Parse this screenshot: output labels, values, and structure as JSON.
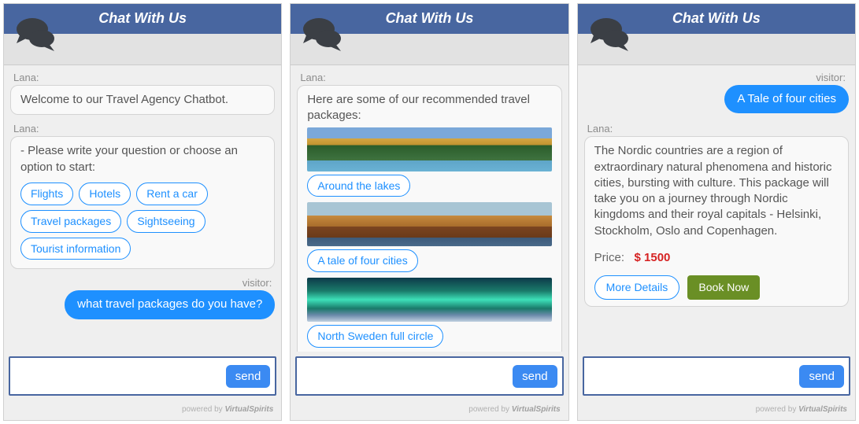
{
  "common": {
    "title": "Chat With Us",
    "send": "send",
    "footer_prefix": "powered  by",
    "footer_brand": "VirtualSpirits",
    "bot_name": "Lana:",
    "visitor_name": "visitor:"
  },
  "panel1": {
    "msg1": "Welcome to our Travel Agency Chatbot.",
    "msg2_intro": "- Please write your question or choose an option to start:",
    "chips": [
      "Flights",
      "Hotels",
      "Rent a car",
      "Travel packages",
      "Sightseeing",
      "Tourist information"
    ],
    "visitor_msg": "what travel packages do you have?"
  },
  "panel2": {
    "msg_intro": "Here are some of our recommended travel packages:",
    "options": [
      "Around the lakes",
      "A tale of four cities",
      "North Sweden full circle"
    ]
  },
  "panel3": {
    "visitor_msg": "A Tale of four cities",
    "desc": "The Nordic countries are a region of extraordinary natural phenomena and historic cities, bursting with culture. This package will take you on a journey through Nordic kingdoms and their royal capitals - Helsinki, Stockholm, Oslo and Copenhagen.",
    "price_label": "Price:",
    "price_value": "$ 1500",
    "more_details": "More Details",
    "book_now": "Book Now"
  }
}
